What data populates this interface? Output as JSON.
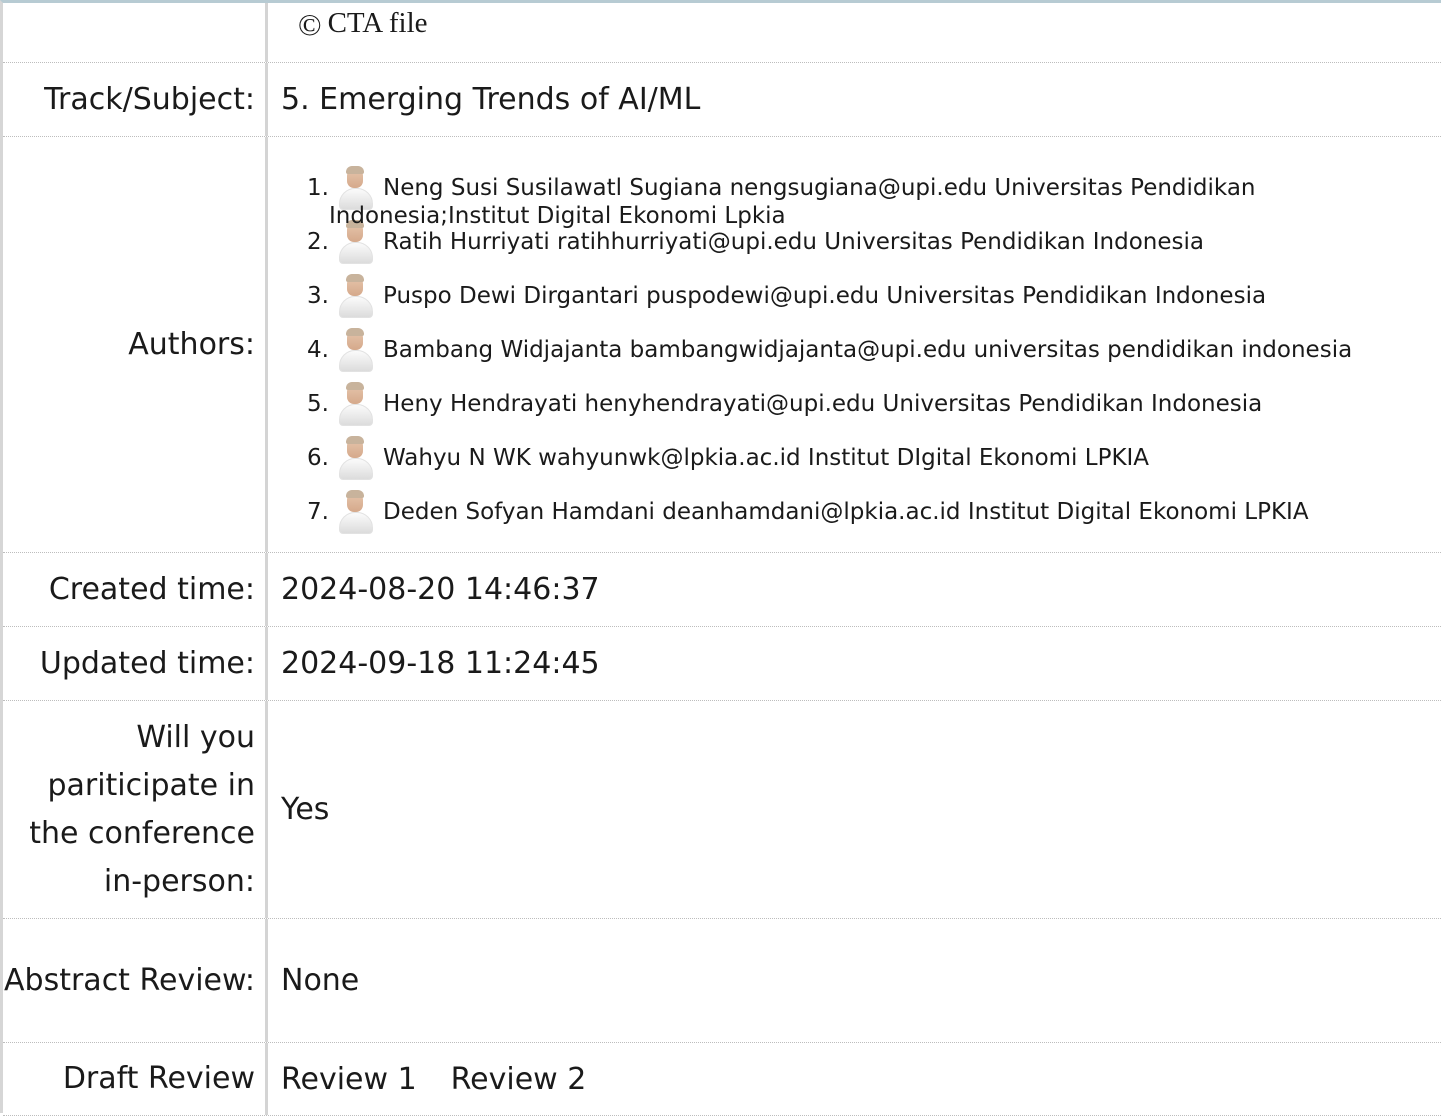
{
  "cta": {
    "symbol": "©",
    "text": "CTA file"
  },
  "track": {
    "label": "Track/Subject:",
    "value": "5. Emerging Trends of AI/ML"
  },
  "authors": {
    "label": "Authors:",
    "overflow": "Indonesia;Institut Digital Ekonomi Lpkia",
    "items": [
      {
        "num": "1.",
        "text": "Neng Susi Susilawatl Sugiana nengsugiana@upi.edu Universitas Pendidikan"
      },
      {
        "num": "2.",
        "text": "Ratih Hurriyati ratihhurriyati@upi.edu Universitas Pendidikan Indonesia"
      },
      {
        "num": "3.",
        "text": "Puspo Dewi Dirgantari puspodewi@upi.edu Universitas Pendidikan Indonesia"
      },
      {
        "num": "4.",
        "text": "Bambang Widjajanta bambangwidjajanta@upi.edu universitas pendidikan indonesia"
      },
      {
        "num": "5.",
        "text": "Heny Hendrayati henyhendrayati@upi.edu Universitas Pendidikan Indonesia"
      },
      {
        "num": "6.",
        "text": "Wahyu N WK wahyunwk@lpkia.ac.id Institut DIgital Ekonomi LPKIA"
      },
      {
        "num": "7.",
        "text": "Deden Sofyan Hamdani deanhamdani@lpkia.ac.id Institut Digital Ekonomi LPKIA"
      }
    ]
  },
  "created": {
    "label": "Created time:",
    "value": "2024-08-20 14:46:37"
  },
  "updated": {
    "label": "Updated time:",
    "value": "2024-09-18 11:24:45"
  },
  "inperson": {
    "label": "Will you pariticipate in the conference in-person:",
    "value": "Yes"
  },
  "abstract": {
    "label": "Abstract Review:",
    "value": "None"
  },
  "draft": {
    "label": "Draft Review",
    "review1": "Review 1",
    "review2": "Review 2"
  }
}
